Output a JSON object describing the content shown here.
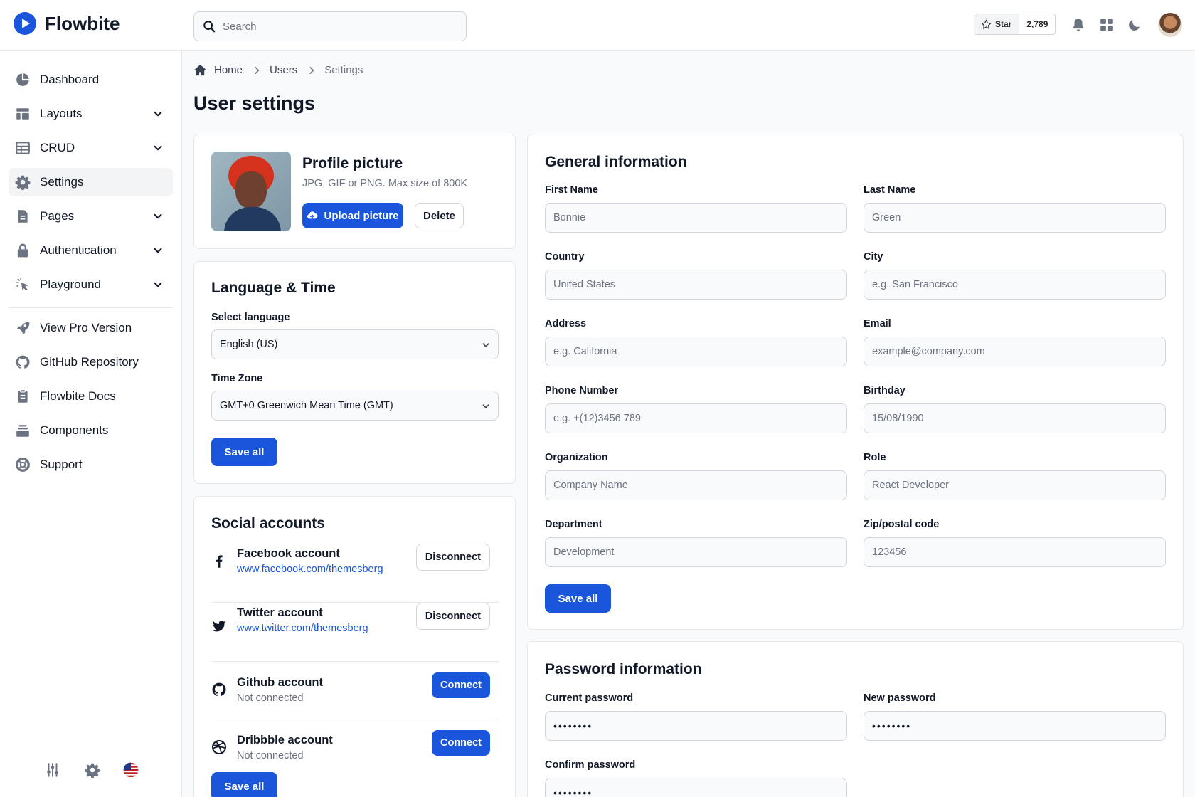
{
  "app": {
    "name": "Flowbite"
  },
  "navbar": {
    "search_placeholder": "Search",
    "github_star_label": "Star",
    "github_star_count": "2,789"
  },
  "sidebar": {
    "items": [
      {
        "label": "Dashboard",
        "icon": "chart-pie-icon"
      },
      {
        "label": "Layouts",
        "icon": "layout-icon",
        "expandable": true
      },
      {
        "label": "CRUD",
        "icon": "table-icon",
        "expandable": true
      },
      {
        "label": "Settings",
        "icon": "gear-icon",
        "active": true
      },
      {
        "label": "Pages",
        "icon": "document-icon",
        "expandable": true
      },
      {
        "label": "Authentication",
        "icon": "lock-icon",
        "expandable": true
      },
      {
        "label": "Playground",
        "icon": "cursor-click-icon",
        "expandable": true
      }
    ],
    "links": [
      {
        "label": "View Pro Version",
        "icon": "rocket-icon"
      },
      {
        "label": "GitHub Repository",
        "icon": "github-icon"
      },
      {
        "label": "Flowbite Docs",
        "icon": "clipboard-icon"
      },
      {
        "label": "Components",
        "icon": "collection-icon"
      },
      {
        "label": "Support",
        "icon": "lifebuoy-icon"
      }
    ]
  },
  "breadcrumb": {
    "home": "Home",
    "users": "Users",
    "current": "Settings"
  },
  "page": {
    "title": "User settings"
  },
  "profile": {
    "title": "Profile picture",
    "hint": "JPG, GIF or PNG. Max size of 800K",
    "upload_label": "Upload picture",
    "delete_label": "Delete"
  },
  "language_time": {
    "title": "Language & Time",
    "language_label": "Select language",
    "language_value": "English (US)",
    "timezone_label": "Time Zone",
    "timezone_value": "GMT+0 Greenwich Mean Time (GMT)",
    "save_label": "Save all"
  },
  "social": {
    "title": "Social accounts",
    "accounts": [
      {
        "name": "Facebook account",
        "detail": "www.facebook.com/themesberg",
        "action": "Disconnect",
        "icon": "facebook-icon"
      },
      {
        "name": "Twitter account",
        "detail": "www.twitter.com/themesberg",
        "action": "Disconnect",
        "icon": "twitter-icon"
      },
      {
        "name": "Github account",
        "detail": "Not connected",
        "action": "Connect",
        "icon": "github-icon"
      },
      {
        "name": "Dribbble account",
        "detail": "Not connected",
        "action": "Connect",
        "icon": "dribbble-icon"
      }
    ],
    "save_label": "Save all"
  },
  "general": {
    "title": "General information",
    "fields": {
      "first_name": {
        "label": "First Name",
        "placeholder": "Bonnie"
      },
      "last_name": {
        "label": "Last Name",
        "placeholder": "Green"
      },
      "country": {
        "label": "Country",
        "placeholder": "United States"
      },
      "city": {
        "label": "City",
        "placeholder": "e.g. San Francisco"
      },
      "address": {
        "label": "Address",
        "placeholder": "e.g. California"
      },
      "email": {
        "label": "Email",
        "placeholder": "example@company.com"
      },
      "phone": {
        "label": "Phone Number",
        "placeholder": "e.g. +(12)3456 789"
      },
      "birthday": {
        "label": "Birthday",
        "placeholder": "15/08/1990"
      },
      "organization": {
        "label": "Organization",
        "placeholder": "Company Name"
      },
      "role": {
        "label": "Role",
        "placeholder": "React Developer"
      },
      "department": {
        "label": "Department",
        "placeholder": "Development"
      },
      "zip": {
        "label": "Zip/postal code",
        "placeholder": "123456"
      }
    },
    "save_label": "Save all"
  },
  "password": {
    "title": "Password information",
    "current_label": "Current password",
    "current_value": "••••••••",
    "new_label": "New password",
    "new_value": "••••••••",
    "confirm_label": "Confirm password",
    "confirm_value": "••••••••"
  },
  "colors": {
    "primary": "#1a56db",
    "border": "#e5e7eb",
    "background": "#f9fafb"
  }
}
